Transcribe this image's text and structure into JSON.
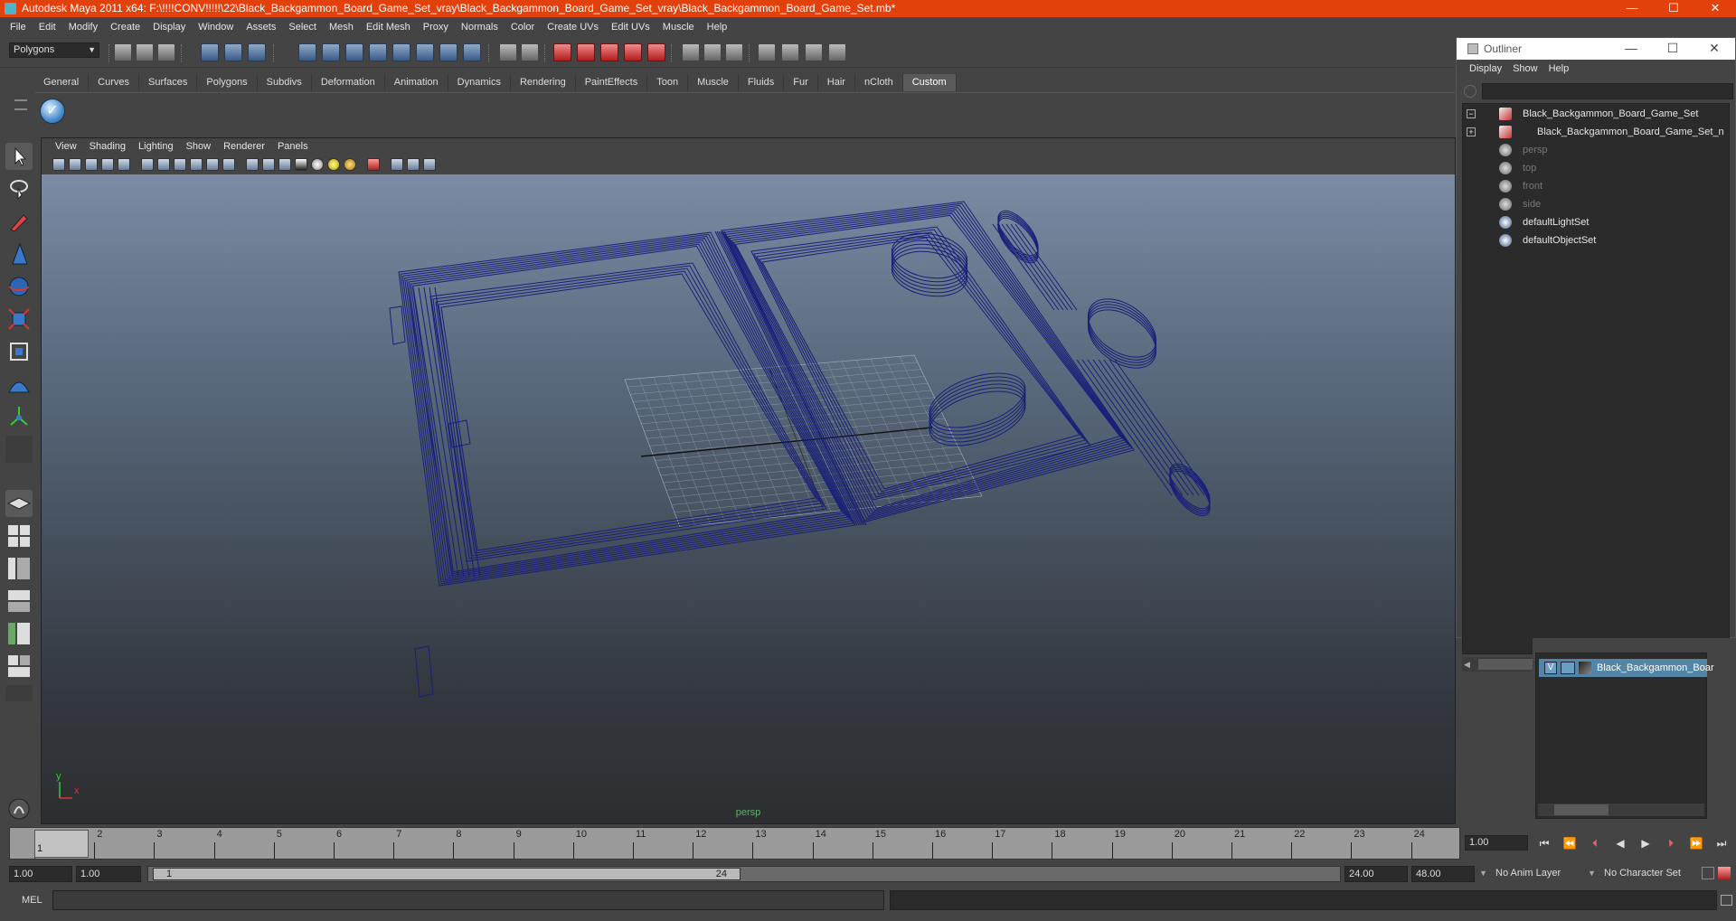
{
  "window": {
    "title": "Autodesk Maya 2011 x64: F:\\!!!!CONV!!!!!\\22\\Black_Backgammon_Board_Game_Set_vray\\Black_Backgammon_Board_Game_Set_vray\\Black_Backgammon_Board_Game_Set.mb*",
    "minimize": "—",
    "maximize": "☐",
    "close": "✕"
  },
  "menubar": [
    "File",
    "Edit",
    "Modify",
    "Create",
    "Display",
    "Window",
    "Assets",
    "Select",
    "Mesh",
    "Edit Mesh",
    "Proxy",
    "Normals",
    "Color",
    "Create UVs",
    "Edit UVs",
    "Muscle",
    "Help"
  ],
  "statusline": {
    "mode": "Polygons"
  },
  "shelf": {
    "tabs": [
      "General",
      "Curves",
      "Surfaces",
      "Polygons",
      "Subdivs",
      "Deformation",
      "Animation",
      "Dynamics",
      "Rendering",
      "PaintEffects",
      "Toon",
      "Muscle",
      "Fluids",
      "Fur",
      "Hair",
      "nCloth",
      "Custom"
    ],
    "active": "Custom"
  },
  "viewport": {
    "menu": [
      "View",
      "Shading",
      "Lighting",
      "Show",
      "Renderer",
      "Panels"
    ],
    "camera": "persp",
    "axis_x": "x",
    "axis_y": "y",
    "wire_color": "#1a1f7a"
  },
  "outliner": {
    "title": "Outliner",
    "menu": [
      "Display",
      "Show",
      "Help"
    ],
    "items": [
      {
        "label": "Black_Backgammon_Board_Game_Set",
        "icon": "mesh-icon",
        "dim": false
      },
      {
        "label": "Black_Backgammon_Board_Game_Set_n",
        "icon": "mesh-icon",
        "dim": false
      },
      {
        "label": "persp",
        "icon": "camera-icon",
        "dim": true
      },
      {
        "label": "top",
        "icon": "camera-icon",
        "dim": true
      },
      {
        "label": "front",
        "icon": "camera-icon",
        "dim": true
      },
      {
        "label": "side",
        "icon": "camera-icon",
        "dim": true
      },
      {
        "label": "defaultLightSet",
        "icon": "set-icon",
        "dim": false
      },
      {
        "label": "defaultObjectSet",
        "icon": "set-icon",
        "dim": false
      }
    ]
  },
  "layers": {
    "visible_flag": "V",
    "name": "Black_Backgammon_Boar"
  },
  "timeline": {
    "ticks": [
      "1",
      "2",
      "3",
      "4",
      "5",
      "6",
      "7",
      "8",
      "9",
      "10",
      "11",
      "12",
      "13",
      "14",
      "15",
      "16",
      "17",
      "18",
      "19",
      "20",
      "21",
      "22",
      "23",
      "24"
    ],
    "current_marker": "1",
    "current_frame": "1.00"
  },
  "range": {
    "start": "1.00",
    "anim_start": "1.00",
    "thumb_start": "1",
    "thumb_end": "24",
    "anim_end": "24.00",
    "end": "48.00",
    "anim_layer": "No Anim Layer",
    "character_set": "No Character Set"
  },
  "command": {
    "label": "MEL"
  }
}
